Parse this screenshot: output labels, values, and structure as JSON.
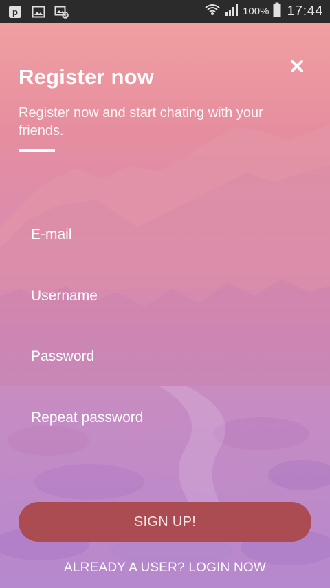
{
  "status_bar": {
    "icons_left": [
      "p-notification-icon",
      "gallery-icon",
      "screenshot-icon"
    ],
    "battery_percent": "100%",
    "time": "17:44"
  },
  "dialog": {
    "title": "Register now",
    "subtitle": "Register now and start chating with your friends.",
    "close_icon": "close-icon"
  },
  "form": {
    "email_placeholder": "E-mail",
    "username_placeholder": "Username",
    "password_placeholder": "Password",
    "repeat_password_placeholder": "Repeat password"
  },
  "actions": {
    "signup_label": "SIGN UP!",
    "login_link": "ALREADY A USER? LOGIN NOW"
  },
  "colors": {
    "gradient_top": "#f2a39f",
    "gradient_bottom": "#b688cd",
    "button": "#ab4b52",
    "status_bar": "#2b2b2b"
  }
}
